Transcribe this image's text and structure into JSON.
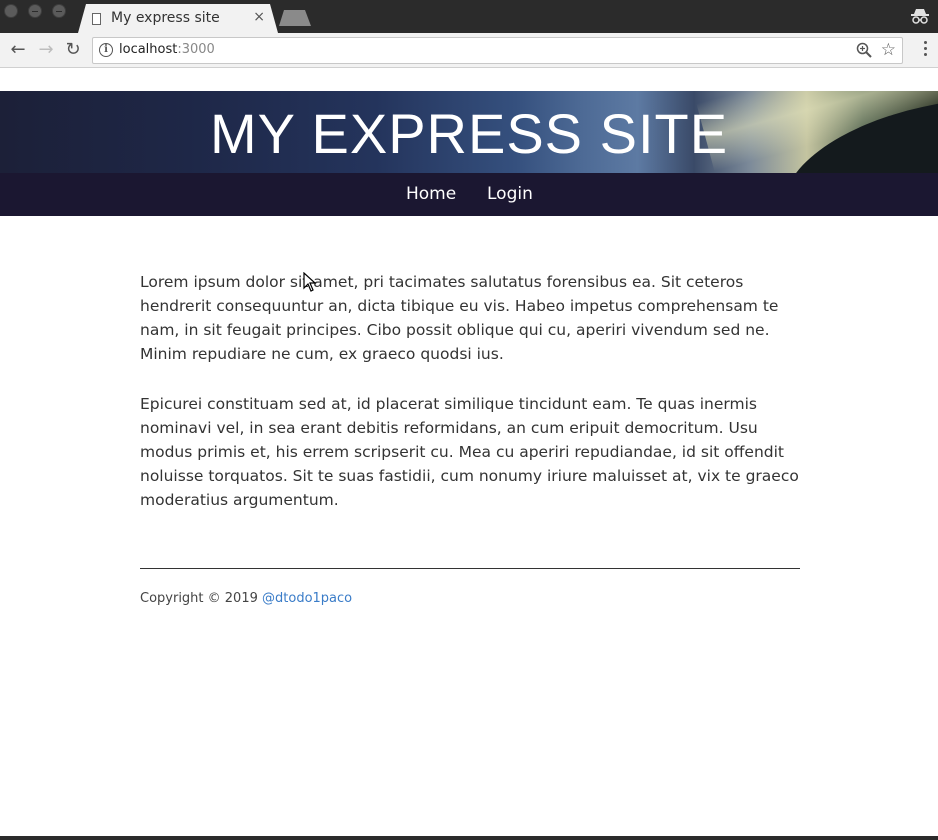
{
  "browser": {
    "tab_title": "My express site",
    "tab_close": "×",
    "url_host": "localhost",
    "url_port": ":3000",
    "info_glyph": "i",
    "back_glyph": "←",
    "forward_glyph": "→",
    "reload_glyph": "↻",
    "star_glyph": "☆"
  },
  "site": {
    "hero_title": "MY EXPRESS SITE",
    "nav": [
      {
        "label": "Home"
      },
      {
        "label": "Login"
      }
    ],
    "paragraphs": [
      "Lorem ipsum dolor sit amet, pri tacimates salutatus forensibus ea. Sit ceteros hendrerit consequuntur an, dicta tibique eu vis. Habeo impetus comprehensam te nam, in sit feugait principes. Cibo possit oblique qui cu, aperiri vivendum sed ne. Minim repudiare ne cum, ex graeco quodsi ius.",
      "Epicurei constituam sed at, id placerat similique tincidunt eam. Te quas inermis nominavi vel, in sea erant debitis reformidans, an cum eripuit democritum. Usu modus primis et, his errem scripserit cu. Mea cu aperiri repudiandae, id sit offendit noluisse torquatos. Sit te suas fastidii, cum nonumy iriure maluisset at, vix te graeco moderatius argumentum."
    ],
    "footer": {
      "copyright": "Copyright © 2019 ",
      "author_link": "@dtodo1paco"
    }
  },
  "colors": {
    "navbar_bg": "#1b1731",
    "link_color": "#3a7cc8",
    "text_color": "#333333"
  }
}
